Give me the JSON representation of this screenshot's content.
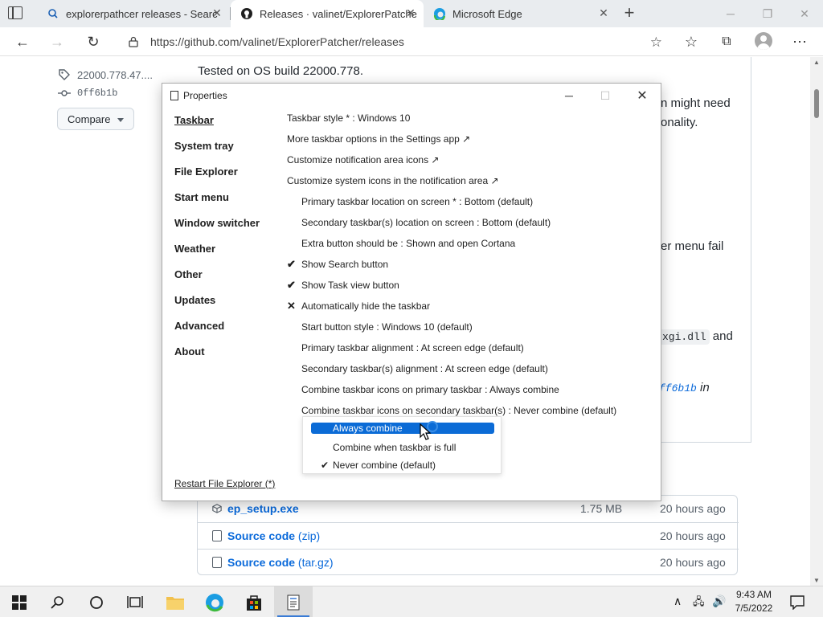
{
  "browser": {
    "tabs": [
      {
        "title": "explorerpathcer releases - Searc",
        "icon": "search-icon",
        "active": false
      },
      {
        "title": "Releases · valinet/ExplorerPatche",
        "icon": "github-icon",
        "active": true
      },
      {
        "title": "Microsoft Edge",
        "icon": "edge-icon",
        "active": false
      }
    ],
    "url": "https://github.com/valinet/ExplorerPatcher/releases"
  },
  "page": {
    "tag": "22000.778.47....",
    "commit": "0ff6b1b",
    "compare_label": "Compare",
    "tested_text": "Tested on OS build 22000.778.",
    "frag_1": "n might need",
    "frag_2": "onality.",
    "frag_3": "er menu fail",
    "frag_4_code": "xgi.dll",
    "frag_4_text": "and",
    "frag_5_link": "ff6b1b",
    "frag_5_text": "in",
    "assets": [
      {
        "name": "ep_setup.exe",
        "suffix": "",
        "size": "1.75 MB",
        "date": "20 hours ago",
        "icon": "package-icon"
      },
      {
        "name": "Source code",
        "suffix": "(zip)",
        "size": "",
        "date": "20 hours ago",
        "icon": "file-zip-icon"
      },
      {
        "name": "Source code",
        "suffix": "(tar.gz)",
        "size": "",
        "date": "20 hours ago",
        "icon": "file-zip-icon"
      }
    ]
  },
  "properties": {
    "title": "Properties",
    "nav": [
      "Taskbar",
      "System tray",
      "File Explorer",
      "Start menu",
      "Window switcher",
      "Weather",
      "Other",
      "Updates",
      "Advanced",
      "About"
    ],
    "options": [
      {
        "text": "Taskbar style * : Windows 10",
        "mark": ""
      },
      {
        "text": "More taskbar options in the Settings app ↗",
        "mark": ""
      },
      {
        "text": "Customize notification area icons ↗",
        "mark": ""
      },
      {
        "text": "Customize system icons in the notification area ↗",
        "mark": ""
      },
      {
        "text": "Primary taskbar location on screen * : Bottom (default)",
        "mark": ""
      },
      {
        "text": "Secondary taskbar(s) location on screen : Bottom (default)",
        "mark": ""
      },
      {
        "text": "Extra button should be : Shown and open Cortana",
        "mark": ""
      },
      {
        "text": "Show Search button",
        "mark": "✔"
      },
      {
        "text": "Show Task view button",
        "mark": "✔"
      },
      {
        "text": "Automatically hide the taskbar",
        "mark": "✕"
      },
      {
        "text": "Start button style : Windows 10 (default)",
        "mark": ""
      },
      {
        "text": "Primary taskbar alignment : At screen edge (default)",
        "mark": ""
      },
      {
        "text": "Secondary taskbar(s) alignment : At screen edge (default)",
        "mark": ""
      },
      {
        "text": "Combine taskbar icons on primary taskbar : Always combine",
        "mark": ""
      },
      {
        "text": "Combine taskbar icons on secondary taskbar(s) : Never combine (default)",
        "mark": ""
      }
    ],
    "dropdown": [
      {
        "label": "Always combine",
        "checked": false,
        "hover": true
      },
      {
        "label": "Combine when taskbar is full",
        "checked": false,
        "hover": false
      },
      {
        "label": "Never combine (default)",
        "checked": true,
        "hover": false
      }
    ],
    "restart_label": "Restart File Explorer (*)"
  },
  "taskbar": {
    "time": "9:43 AM",
    "date": "7/5/2022"
  },
  "colors": {
    "accent": "#0b6bd6",
    "link": "#0969da"
  }
}
